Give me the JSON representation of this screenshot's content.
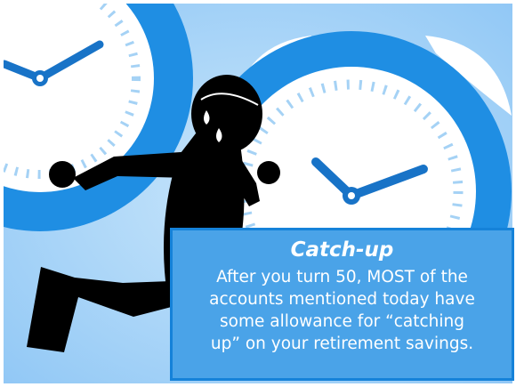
{
  "caption": {
    "title": "Catch-up",
    "body": "After you turn 50, MOST of the\naccounts mentioned today have\nsome allowance for “catching\nup” on  your retirement savings."
  },
  "colors": {
    "background": "#8ec6f5",
    "clock_ring": "#1f8ee3",
    "clock_face": "#ffffff",
    "clock_ticks": "#a5d2f5",
    "clock_hands": "#1873c7",
    "caption_fill": "#4aa3e8",
    "caption_border": "#1582d9",
    "silhouette": "#000000"
  },
  "icons": [
    "alarm-clock-icon",
    "wall-clock-icon",
    "running-man-icon",
    "sweat-drop-icon"
  ]
}
